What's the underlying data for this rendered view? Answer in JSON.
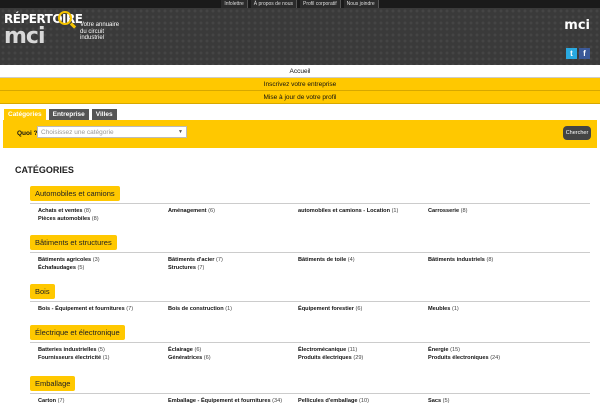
{
  "topbar": {
    "links": [
      "Infolettre",
      "À propos de nous",
      "Profil corporatif",
      "Nous joindre"
    ]
  },
  "header": {
    "logo_top": "RÉPERTOIRE",
    "logo_main": "mci",
    "tagline": "Votre annuaire du circuit industriel",
    "brand_right": "mci"
  },
  "social": {
    "twitter": "t",
    "facebook": "f"
  },
  "nav": {
    "accueil": "Accueil",
    "inscrivez": "Inscrivez votre entreprise",
    "mise_a_jour": "Mise à jour de votre profil"
  },
  "tabs": [
    "Catégories",
    "Entreprise",
    "Villes"
  ],
  "search": {
    "label": "Quoi ?",
    "placeholder": "Choisissez une catégorie",
    "button": "Chercher"
  },
  "main_title": "CATÉGORIES",
  "categories": [
    {
      "name": "Automobiles et camions",
      "items": [
        {
          "label": "Achats et ventes",
          "count": "(8)"
        },
        {
          "label": "Aménagement",
          "count": "(6)"
        },
        {
          "label": "automobiles et camions - Location",
          "count": "(1)"
        },
        {
          "label": "Carrosserie",
          "count": "(8)"
        },
        {
          "label": "Pièces automobiles",
          "count": "(8)"
        }
      ]
    },
    {
      "name": "Bâtiments et structures",
      "items": [
        {
          "label": "Bâtiments agricoles",
          "count": "(3)"
        },
        {
          "label": "Bâtiments d'acier",
          "count": "(7)"
        },
        {
          "label": "Bâtiments de toile",
          "count": "(4)"
        },
        {
          "label": "Bâtiments industriels",
          "count": "(8)"
        },
        {
          "label": "Échafaudages",
          "count": "(5)"
        },
        {
          "label": "Structures",
          "count": "(7)"
        }
      ]
    },
    {
      "name": "Bois",
      "items": [
        {
          "label": "Bois - Équipement et fournitures",
          "count": "(7)"
        },
        {
          "label": "Bois de construction",
          "count": "(1)"
        },
        {
          "label": "Équipement forestier",
          "count": "(6)"
        },
        {
          "label": "Meubles",
          "count": "(1)"
        }
      ]
    },
    {
      "name": "Électrique et électronique",
      "items": [
        {
          "label": "Batteries industrielles",
          "count": "(5)"
        },
        {
          "label": "Éclairage",
          "count": "(6)"
        },
        {
          "label": "Électromécanique",
          "count": "(11)"
        },
        {
          "label": "Énergie",
          "count": "(15)"
        },
        {
          "label": "Fournisseurs électricité",
          "count": "(1)"
        },
        {
          "label": "Génératrices",
          "count": "(6)"
        },
        {
          "label": "Produits électriques",
          "count": "(29)"
        },
        {
          "label": "Produits électroniques",
          "count": "(24)"
        }
      ]
    },
    {
      "name": "Emballage",
      "items": [
        {
          "label": "Carton",
          "count": "(7)"
        },
        {
          "label": "Emballage - Équipement et fournitures",
          "count": "(34)"
        },
        {
          "label": "Pellicules d'emballage",
          "count": "(10)"
        },
        {
          "label": "Sacs",
          "count": "(5)"
        }
      ]
    }
  ]
}
